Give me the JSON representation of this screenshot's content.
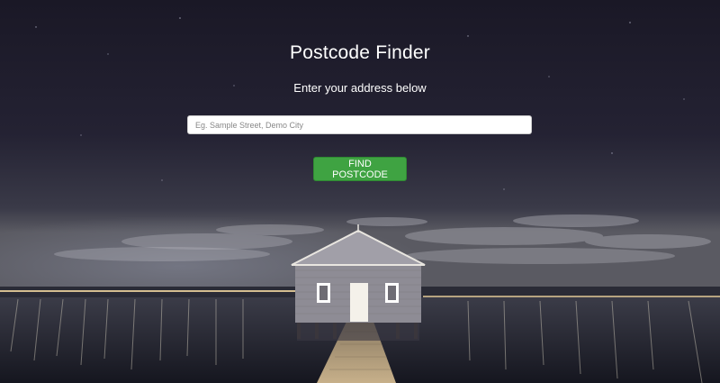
{
  "page": {
    "title": "Postcode Finder",
    "subtitle": "Enter your address below"
  },
  "search": {
    "placeholder": "Eg. Sample Street, Demo City",
    "value": ""
  },
  "actions": {
    "find_label": "FIND POSTCODE"
  },
  "colors": {
    "button_bg": "#3fa342",
    "sky_top": "#1a1826",
    "water": "#1b1d2a"
  }
}
